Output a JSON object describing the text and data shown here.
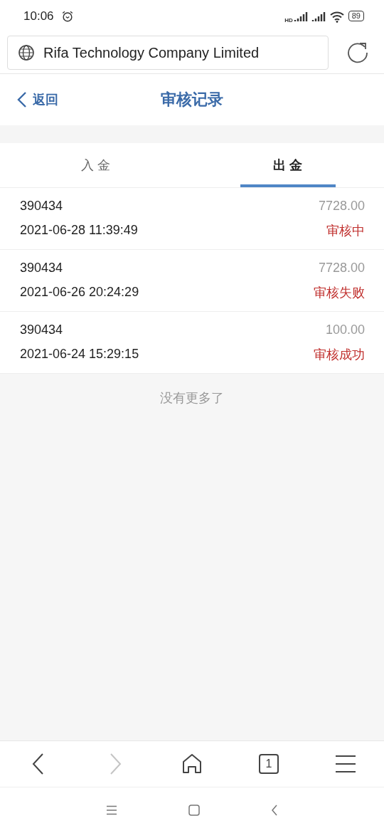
{
  "status_bar": {
    "time": "10:06",
    "battery": "89",
    "hd": "HD"
  },
  "address_bar": {
    "title": "Rifa Technology Company Limited"
  },
  "header": {
    "back": "返回",
    "title": "审核记录"
  },
  "tabs": [
    {
      "label": "入 金",
      "selected": false
    },
    {
      "label": "出 金",
      "selected": true
    }
  ],
  "records": [
    {
      "account": "390434",
      "amount": "7728.00",
      "time": "2021-06-28 11:39:49",
      "status": "审核中"
    },
    {
      "account": "390434",
      "amount": "7728.00",
      "time": "2021-06-26 20:24:29",
      "status": "审核失败"
    },
    {
      "account": "390434",
      "amount": "100.00",
      "time": "2021-06-24 15:29:15",
      "status": "审核成功"
    }
  ],
  "end_note": "没有更多了",
  "browser_toolbar": [
    {
      "kind": "back",
      "disabled": false
    },
    {
      "kind": "forward",
      "disabled": true
    },
    {
      "kind": "home",
      "disabled": false
    },
    {
      "kind": "tabs",
      "label": "1",
      "disabled": false
    },
    {
      "kind": "menu",
      "disabled": false
    }
  ]
}
